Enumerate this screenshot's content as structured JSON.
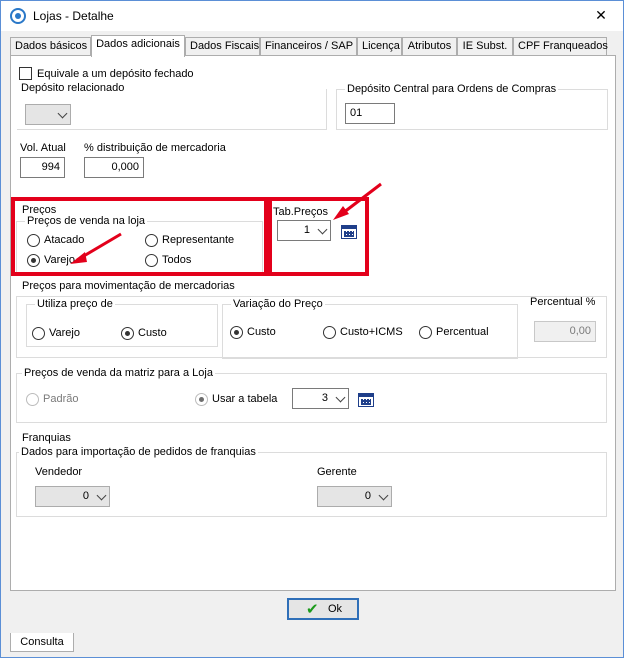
{
  "window": {
    "title": "Lojas - Detalhe",
    "close_symbol": "✕"
  },
  "tabs": [
    "Dados básicos",
    "Dados adicionais",
    "Dados Fiscais",
    "Financeiros / SAP",
    "Licença",
    "Atributos",
    "IE Subst.",
    "CPF Franqueados"
  ],
  "active_tab": "Dados adicionais",
  "deposito": {
    "checkbox_label": "Equivale a um depósito fechado",
    "checked": false,
    "relacionado_label": "Depósito relacionado",
    "relacionado_value": "",
    "central_label": "Depósito Central para Ordens de Compras",
    "central_value": "01"
  },
  "vol": {
    "label": "Vol. Atual",
    "value": "994",
    "dist_label": "% distribuição de mercadoria",
    "dist_value": "0,000"
  },
  "precos": {
    "section_label": "Preços",
    "venda_group_label": "Preços de venda na loja",
    "options": {
      "atacado": "Atacado",
      "representante": "Representante",
      "varejo": "Varejo",
      "todos": "Todos"
    },
    "selected": "Varejo",
    "tab_precos_label": "Tab.Preços",
    "tab_precos_value": "1"
  },
  "movimentacao": {
    "section_label": "Preços para movimentação de mercadorias",
    "utiliza_label": "Utiliza preço de",
    "utiliza_options": {
      "varejo": "Varejo",
      "custo": "Custo"
    },
    "utiliza_selected": "Custo",
    "variacao_label": "Variação do Preço",
    "variacao_options": {
      "custo": "Custo",
      "custo_icms": "Custo+ICMS",
      "percentual": "Percentual"
    },
    "variacao_selected": "Custo",
    "percentual_label": "Percentual %",
    "percentual_value": "0,00"
  },
  "matriz": {
    "group_label": "Preços de venda da matriz para a Loja",
    "options": {
      "padrao": "Padrão",
      "usar_tabela": "Usar a tabela"
    },
    "selected": "Usar a tabela",
    "tabela_value": "3"
  },
  "franquias": {
    "section_label": "Franquias",
    "group_label": "Dados para importação de pedidos de franquias",
    "vendedor_label": "Vendedor",
    "vendedor_value": "0",
    "gerente_label": "Gerente",
    "gerente_value": "0"
  },
  "buttons": {
    "ok_label": "Ok",
    "ok_icon": "check-icon"
  },
  "bottom_tab": "Consulta",
  "colors": {
    "highlight": "#e3001b",
    "accent": "#2f6fb8"
  }
}
